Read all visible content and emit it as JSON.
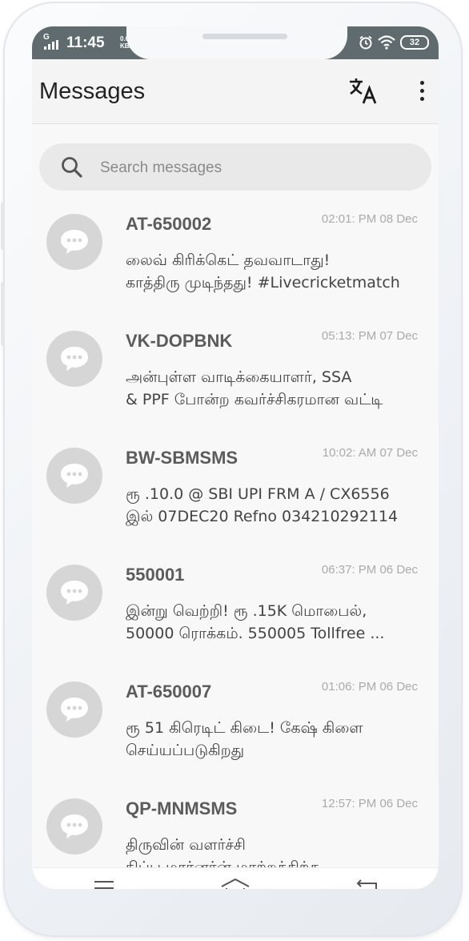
{
  "status_bar": {
    "signal_label": "G",
    "time": "11:45",
    "net_speed": "0.0 KB/s",
    "battery": "32",
    "icons": [
      "signal-icon",
      "alarm-icon",
      "wifi-icon",
      "battery-icon"
    ]
  },
  "app_bar": {
    "title": "Messages",
    "icons": [
      "translate-icon",
      "more-vert-icon"
    ]
  },
  "search": {
    "placeholder": "Search messages",
    "icon": "search-icon"
  },
  "messages": [
    {
      "sender": "AT-650002",
      "date": "02:01: PM 08 Dec",
      "line1": "லைவ் கிரிக்கெட் தவவாடாது!",
      "line2": "காத்திரு முடிந்தது! #Livecricketmatch"
    },
    {
      "sender": "VK-DOPBNK",
      "date": "05:13: PM 07 Dec",
      "line1": "அன்புள்ள வாடிக்கையாளர், SSA",
      "line2": "& PPF போன்ற கவர்ச்சிகரமான வட்டி"
    },
    {
      "sender": "BW-SBMSMS",
      "date": "10:02: AM 07 Dec",
      "line1": "ரூ .10.0 @ SBI UPI FRM A / CX6556",
      "line2": "இல் 07DEC20 Refno 034210292114"
    },
    {
      "sender": "550001",
      "date": "06:37: PM 06 Dec",
      "line1": "இன்று வெற்றி! ரூ .15K மொபைல்,",
      "line2": "50000 ரொக்கம். 550005 Tollfree ..."
    },
    {
      "sender": "AT-650007",
      "date": "01:06: PM 06 Dec",
      "line1": "ரூ 51 கிரெடிட் கிடை! கேஷ் கிளை",
      "line2": "செய்யப்படுகிறது"
    },
    {
      "sender": "QP-MNMSMS",
      "date": "12:57: PM 06 Dec",
      "line1": "திருவின் வளர்ச்சி",
      "line2": "நிப்பு மார்னர்ன் மாற்றக்கிற்க"
    }
  ],
  "nav_bar": {
    "icons": [
      "menu-icon",
      "home-icon",
      "back-icon"
    ]
  },
  "colors": {
    "status_bar": "#5f6b6e",
    "app_bar": "#f4f4f4",
    "background": "#f8f8f8",
    "avatar": "#d6d6d6",
    "sender_text": "#5b5b5b",
    "date_text": "#aaaaaa"
  }
}
